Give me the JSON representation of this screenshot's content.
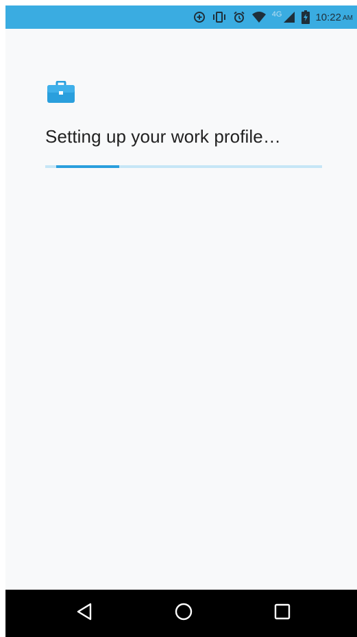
{
  "status_bar": {
    "icons": [
      "data-saver-icon",
      "vibrate-icon",
      "alarm-icon",
      "wifi-icon",
      "signal-icon",
      "battery-charging-icon"
    ],
    "network_type": "4G",
    "time": "10:22",
    "ampm": "AM",
    "background_color": "#3aace1"
  },
  "main": {
    "icon": "briefcase-icon",
    "icon_color": "#2a9fdd",
    "title": "Setting up your work profile…",
    "progress": {
      "indeterminate": true,
      "track_color": "#c6e6f6",
      "fill_color": "#2a9fdd"
    }
  },
  "nav_bar": {
    "buttons": [
      "back-icon",
      "home-icon",
      "recents-icon"
    ]
  }
}
